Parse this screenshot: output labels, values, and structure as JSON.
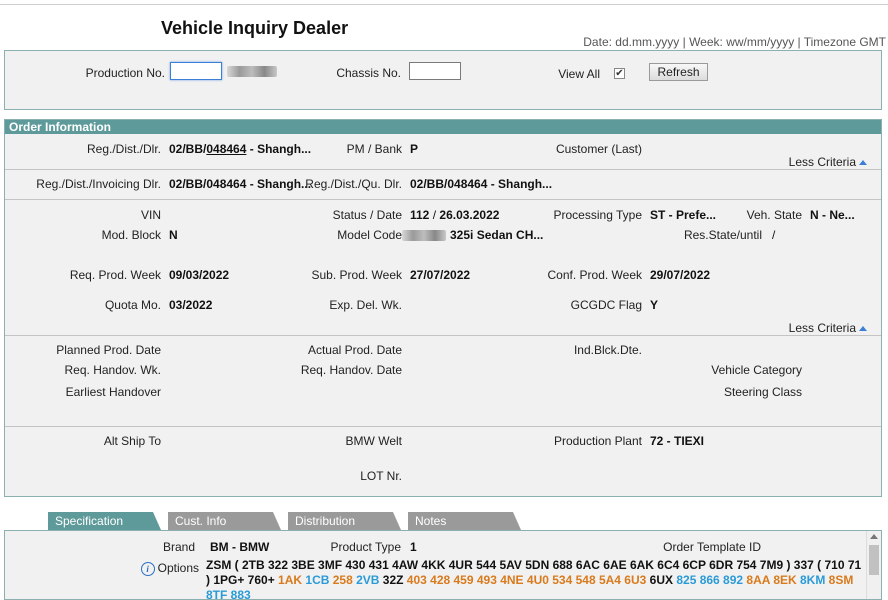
{
  "header": {
    "title": "Vehicle Inquiry Dealer",
    "format_note": "Date: dd.mm.yyyy | Week: ww/mm/yyyy | Timezone GMT"
  },
  "search": {
    "production_no_label": "Production No.",
    "production_no_value": "",
    "chassis_no_label": "Chassis No.",
    "chassis_no_value": "",
    "view_all_label": "View All",
    "view_all_checked": "✔",
    "refresh_label": "Refresh"
  },
  "order_info": {
    "header": "Order Information",
    "less_criteria": "Less Criteria",
    "row1": {
      "reg_dist_dlr_label": "Reg./Dist./Dlr.",
      "reg_dist_dlr_prefix": "02/BB/",
      "reg_dist_dlr_link": "048464",
      "reg_dist_dlr_suffix": " - Shangh...",
      "pm_bank_label": "PM / Bank",
      "pm_bank_value": "P",
      "customer_label": "Customer (Last)"
    },
    "row2": {
      "invoicing_label": "Reg./Dist./Invoicing Dlr.",
      "invoicing_value": "02/BB/048464 - Shangh...",
      "qu_label": "Reg./Dist./Qu. Dlr.",
      "qu_value": "02/BB/048464 - Shangh..."
    },
    "vehicle": {
      "vin_label": "VIN",
      "status_date_label": "Status / Date",
      "status_value": "112",
      "status_sep": "/",
      "status_date": "26.03.2022",
      "processing_type_label": "Processing Type",
      "processing_type_value": "ST - Prefe...",
      "veh_state_label": "Veh. State",
      "veh_state_value": "N - Ne...",
      "mod_block_label": "Mod. Block",
      "mod_block_value": "N",
      "model_code_label": "Model Code",
      "model_code_value": "325i Sedan CH...",
      "res_state_label": "Res.State/until",
      "res_state_value": "/",
      "req_prod_week_label": "Req. Prod. Week",
      "req_prod_week_value": "09/03/2022",
      "sub_prod_week_label": "Sub. Prod. Week",
      "sub_prod_week_value": "27/07/2022",
      "conf_prod_week_label": "Conf. Prod. Week",
      "conf_prod_week_value": "29/07/2022",
      "quota_mo_label": "Quota Mo.",
      "quota_mo_value": "03/2022",
      "exp_del_wk_label": "Exp. Del. Wk.",
      "gcgdc_flag_label": "GCGDC Flag",
      "gcgdc_flag_value": "Y"
    },
    "dates": {
      "planned_prod_date_label": "Planned Prod. Date",
      "actual_prod_date_label": "Actual Prod. Date",
      "ind_blck_dte_label": "Ind.Blck.Dte.",
      "req_handov_wk_label": "Req. Handov. Wk.",
      "req_handov_date_label": "Req. Handov. Date",
      "vehicle_category_label": "Vehicle Category",
      "earliest_handover_label": "Earliest Handover",
      "steering_class_label": "Steering Class"
    },
    "shipping": {
      "alt_ship_to_label": "Alt Ship To",
      "bmw_welt_label": "BMW Welt",
      "production_plant_label": "Production Plant",
      "production_plant_value": "72 - TIEXI",
      "lot_nr_label": "LOT Nr."
    }
  },
  "tabs": [
    {
      "label": "Specification",
      "active": true
    },
    {
      "label": "Cust. Info",
      "active": false
    },
    {
      "label": "Distribution",
      "active": false
    },
    {
      "label": "Notes",
      "active": false
    }
  ],
  "specification": {
    "brand_label": "Brand",
    "brand_value": "BM - BMW",
    "product_type_label": "Product Type",
    "product_type_value": "1",
    "order_template_label": "Order Template ID",
    "options_label": "Options",
    "options_line1": "ZSM ( 2TB 322 3BE 3MF 430 431 4AW 4KK 4UR 544 5AV 5DN 688 6AC 6AE 6AK 6C4 6CP 6DR 754 7M9 ) 337 ( 710 71",
    "options_line2": [
      {
        "text": ") 1PG+ 760+ ",
        "color": "default"
      },
      {
        "text": "1AK ",
        "color": "orange"
      },
      {
        "text": "1CB ",
        "color": "blue"
      },
      {
        "text": "258 ",
        "color": "orange"
      },
      {
        "text": "2VB ",
        "color": "blue"
      },
      {
        "text": "32Z ",
        "color": "default"
      },
      {
        "text": "403 428 459 493 4NE 4U0 534 548 5A4 6U3 ",
        "color": "orange"
      },
      {
        "text": "6UX ",
        "color": "default"
      },
      {
        "text": "825 866 892 ",
        "color": "blue"
      },
      {
        "text": "8AA 8EK ",
        "color": "orange"
      },
      {
        "text": "8KM ",
        "color": "blue"
      },
      {
        "text": "8SM",
        "color": "orange"
      }
    ],
    "options_line3": "8TF 883"
  },
  "colors": {
    "accent": "#5e9a9a",
    "tab_inactive": "#9a9a9a",
    "option_orange": "#d97a1c",
    "option_blue": "#2a9bd7"
  }
}
